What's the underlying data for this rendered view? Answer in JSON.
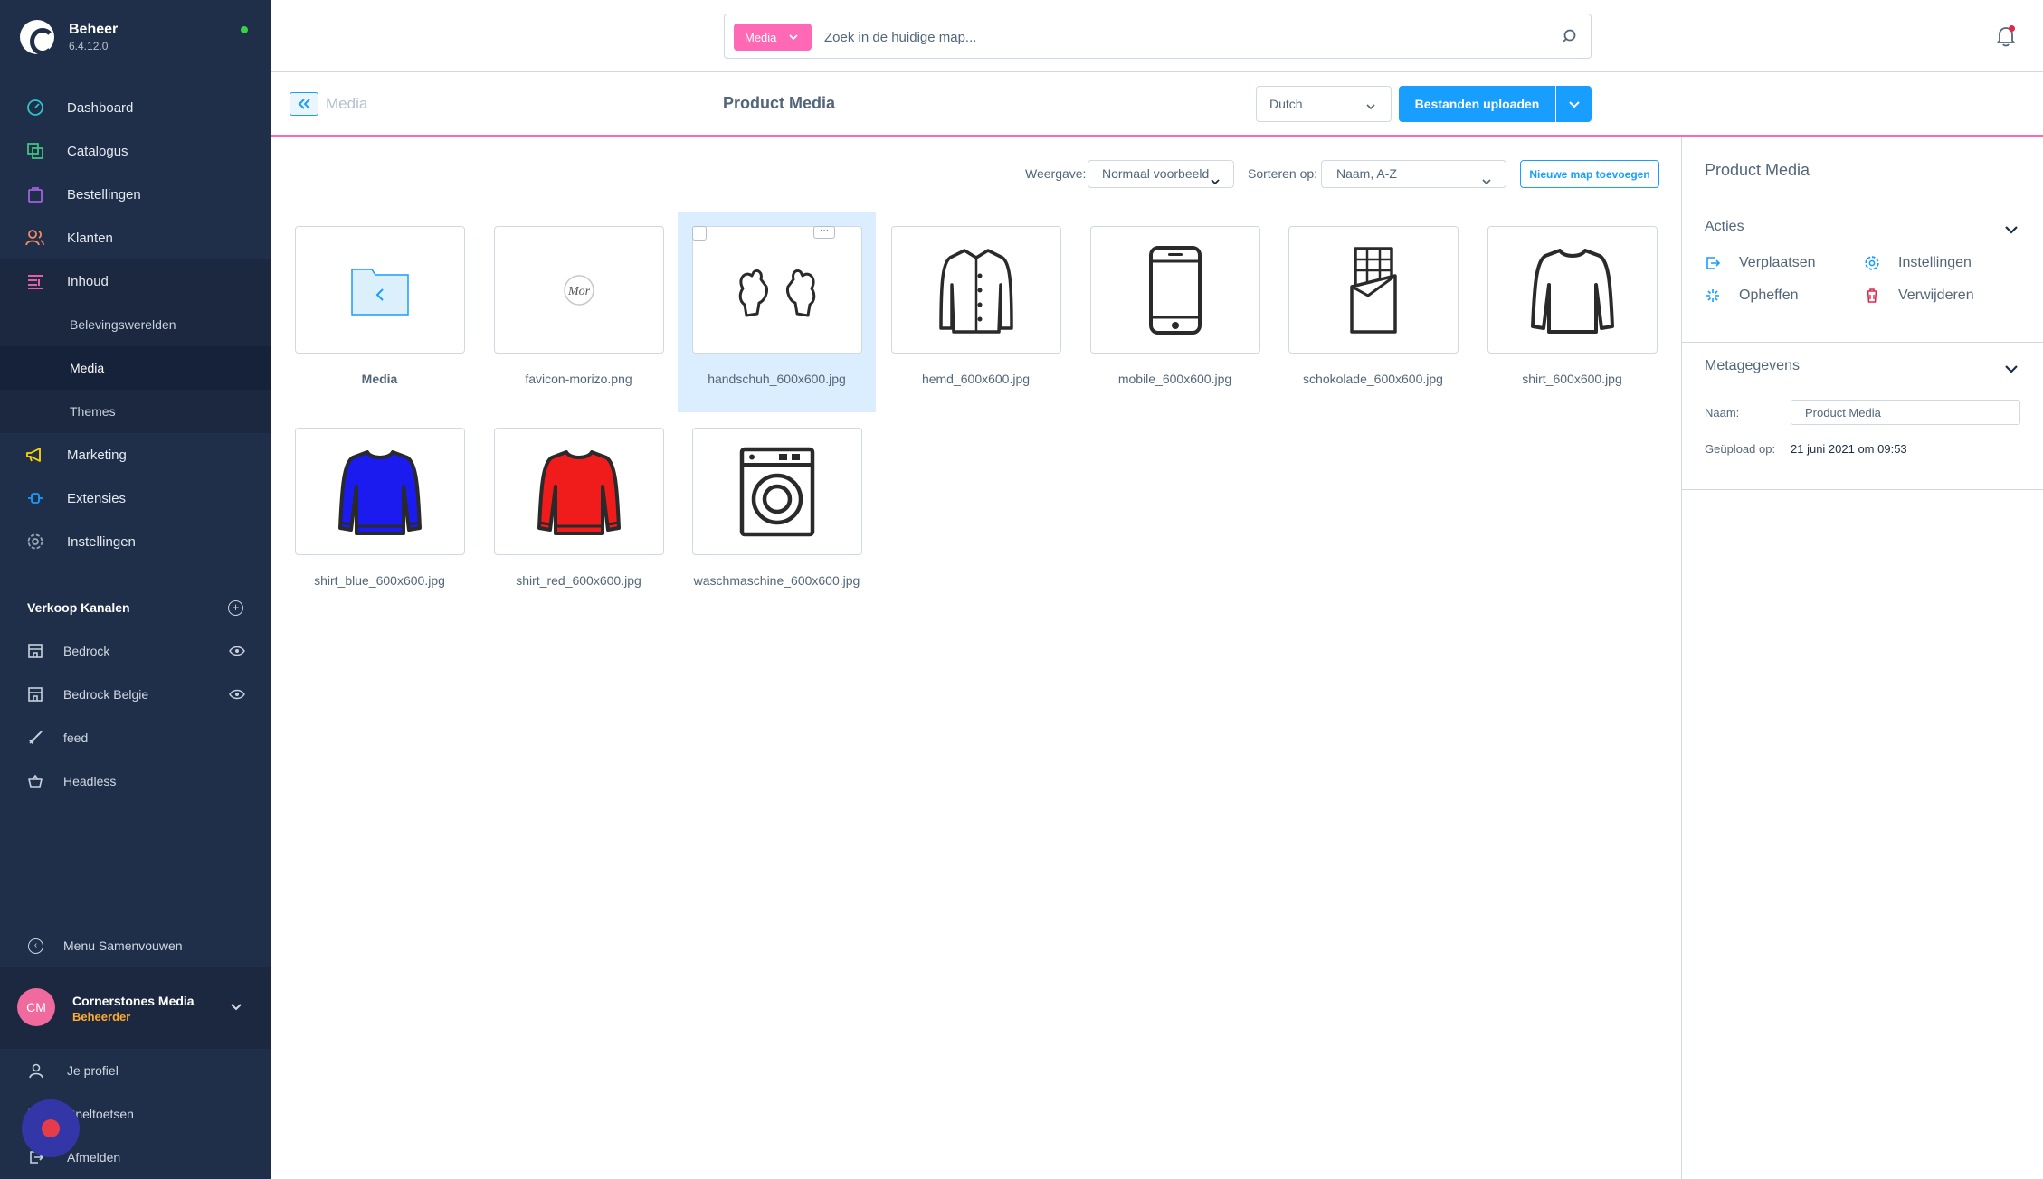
{
  "app": {
    "title": "Beheer",
    "version": "6.4.12.0"
  },
  "sidebar": {
    "nav": [
      {
        "label": "Dashboard",
        "icon": "dashboard-icon"
      },
      {
        "label": "Catalogus",
        "icon": "catalog-icon"
      },
      {
        "label": "Bestellingen",
        "icon": "orders-icon"
      },
      {
        "label": "Klanten",
        "icon": "customers-icon"
      },
      {
        "label": "Inhoud",
        "icon": "content-icon"
      },
      {
        "label": "Marketing",
        "icon": "marketing-icon"
      },
      {
        "label": "Extensies",
        "icon": "extensions-icon"
      },
      {
        "label": "Instellingen",
        "icon": "settings-icon"
      }
    ],
    "sub": [
      {
        "label": "Belevingswerelden"
      },
      {
        "label": "Media"
      },
      {
        "label": "Themes"
      }
    ],
    "sales_channels_title": "Verkoop Kanalen",
    "sales_channels": [
      {
        "label": "Bedrock"
      },
      {
        "label": "Bedrock Belgie"
      },
      {
        "label": "feed"
      },
      {
        "label": "Headless"
      }
    ],
    "collapse_label": "Menu Samenvouwen",
    "user": {
      "initials": "CM",
      "name": "Cornerstones Media",
      "role": "Beheerder"
    },
    "bottom": [
      {
        "label": "Je profiel"
      },
      {
        "label": "Sneltoetsen"
      },
      {
        "label": "Afmelden"
      }
    ]
  },
  "search": {
    "scope": "Media",
    "placeholder": "Zoek in de huidige map..."
  },
  "header": {
    "breadcrumb": "Media",
    "title": "Product Media",
    "language": "Dutch",
    "upload_label": "Bestanden uploaden"
  },
  "toolbar": {
    "view_label": "Weergave:",
    "view_value": "Normaal voorbeeld",
    "sort_label": "Sorteren op:",
    "sort_value": "Naam, A-Z",
    "new_folder_label": "Nieuwe map toevoegen"
  },
  "media_items": [
    {
      "name": "Media",
      "type": "folder"
    },
    {
      "name": "favicon-morizo.png",
      "type": "logo"
    },
    {
      "name": "handschuh_600x600.jpg",
      "type": "gloves",
      "selected": true
    },
    {
      "name": "hemd_600x600.jpg",
      "type": "shirt-buttons"
    },
    {
      "name": "mobile_600x600.jpg",
      "type": "phone"
    },
    {
      "name": "schokolade_600x600.jpg",
      "type": "chocolate"
    },
    {
      "name": "shirt_600x600.jpg",
      "type": "longsleeve"
    },
    {
      "name": "shirt_blue_600x600.jpg",
      "type": "longsleeve-blue",
      "color": "#1b1bf0"
    },
    {
      "name": "shirt_red_600x600.jpg",
      "type": "longsleeve-red",
      "color": "#f01b1b"
    },
    {
      "name": "waschmaschine_600x600.jpg",
      "type": "washer"
    }
  ],
  "panel": {
    "title": "Product Media",
    "actions_title": "Acties",
    "actions": {
      "move": "Verplaatsen",
      "settings": "Instellingen",
      "dissolve": "Opheffen",
      "delete": "Verwijderen"
    },
    "meta_title": "Metagegevens",
    "name_label": "Naam:",
    "name_value": "Product Media",
    "uploaded_label": "Geüpload op:",
    "uploaded_value": "21 juni 2021 om 09:53"
  },
  "colors": {
    "sidebar": "#1f2f4a",
    "accent": "#189eff",
    "pink": "#ff68b4",
    "online": "#37d046",
    "delete": "#de294c"
  }
}
